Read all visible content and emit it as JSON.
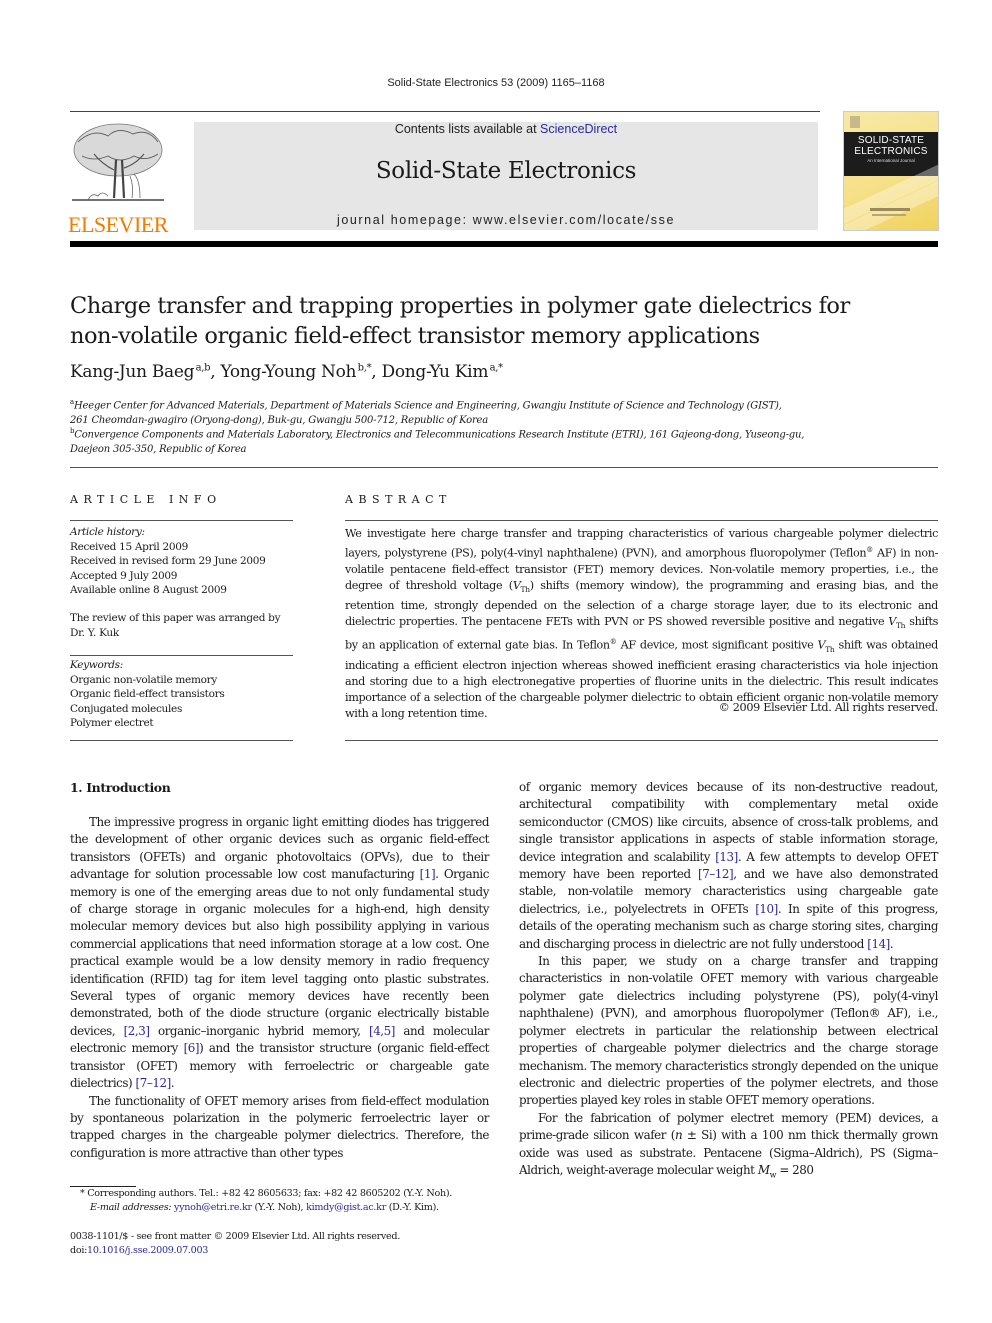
{
  "running_head": "Solid-State Electronics 53 (2009) 1165–1168",
  "publisher": {
    "logo_word": "ELSEVIER",
    "logo_color": "#f07c00"
  },
  "banner": {
    "contents_prefix": "Contents lists available at ",
    "contents_link": "ScienceDirect",
    "journal_title": "Solid-State Electronics",
    "homepage": "journal homepage: www.elsevier.com/locate/sse"
  },
  "cover": {
    "line1": "SOLID-STATE",
    "line2": "ELECTRONICS",
    "line3": "An International Journal"
  },
  "article": {
    "title_line1": "Charge transfer and trapping properties in polymer gate dielectrics for",
    "title_line2": "non-volatile organic field-effect transistor memory applications",
    "authors": [
      {
        "name": "Kang-Jun Baeg",
        "sup": "a,b",
        "sep": ", "
      },
      {
        "name": "Yong-Young Noh",
        "sup": "b,*",
        "sep": ", "
      },
      {
        "name": "Dong-Yu Kim",
        "sup": "a,*",
        "sep": ""
      }
    ],
    "affiliations": [
      {
        "mark": "a",
        "line1": "Heeger Center for Advanced Materials, Department of Materials Science and Engineering, Gwangju Institute of Science and Technology (GIST),",
        "line2": "261 Cheomdan-gwagiro (Oryong-dong), Buk-gu, Gwangju 500-712, Republic of Korea"
      },
      {
        "mark": "b",
        "line1": "Convergence Components and Materials Laboratory, Electronics and Telecommunications Research Institute (ETRI), 161 Gajeong-dong, Yuseong-gu,",
        "line2": "Daejeon 305-350, Republic of Korea"
      }
    ]
  },
  "article_info": {
    "heading": "ARTICLE INFO",
    "history_label": "Article history:",
    "history": [
      "Received 15 April 2009",
      "Received in revised form 29 June 2009",
      "Accepted 9 July 2009",
      "Available online 8 August 2009"
    ],
    "review_note": "The review of this paper was arranged by Dr. Y. Kuk",
    "keywords_label": "Keywords:",
    "keywords": [
      "Organic non-volatile memory",
      "Organic field-effect transistors",
      "Conjugated molecules",
      "Polymer electret"
    ]
  },
  "abstract": {
    "heading": "ABSTRACT",
    "p1": "We investigate here charge transfer and trapping characteristics of various chargeable polymer dielectric layers, polystyrene (PS), poly(4-vinyl naphthalene) (PVN), and amorphous fluoropolymer (Teflon",
    "reg": "®",
    "p2": " AF) in non-volatile pentacene field-effect transistor (FET) memory devices. Non-volatile memory properties, i.e., the degree of threshold voltage (",
    "vth_v": "V",
    "vth_sub": "Th",
    "p3": ") shifts (memory window), the programming and erasing bias, and the retention time, strongly depended on the selection of a charge storage layer, due to its electronic and dielectric properties. The pentacene FETs with PVN or PS showed reversible positive and negative ",
    "p4": " shifts by an application of external gate bias. In Teflon",
    "p5": " AF device, most significant positive ",
    "p6": " shift was obtained indicating a efficient electron injection whereas showed inefficient erasing characteristics via hole injection and storing due to a high electronegative properties of fluorine units in the dielectric. This result indicates importance of a selection of the chargeable polymer dielectric to obtain efficient organic non-volatile memory with a long retention time.",
    "copyright": "© 2009 Elsevier Ltd. All rights reserved."
  },
  "section1": {
    "heading": "1. Introduction",
    "left_p1": [
      {
        "t": "The impressive progress in organic light emitting diodes has triggered the development of other organic devices such as organic field-effect transistors (OFETs) and organic photovoltaics (OPVs), due to their advantage for solution processable low cost manufacturing "
      },
      {
        "ref": "[1]"
      },
      {
        "t": ". Organic memory is one of the emerging areas due to not only fundamental study of charge storage in organic molecules for a high-end, high density molecular memory devices but also high possibility applying in various commercial applications that need information storage at a low cost. One practical example would be a low density memory in radio frequency identification (RFID) tag for item level tagging onto plastic substrates. Several types of organic memory devices have recently been demonstrated, both of the diode structure (organic electrically bistable devices, "
      },
      {
        "ref": "[2,3]"
      },
      {
        "t": " organic–inorganic hybrid memory, "
      },
      {
        "ref": "[4,5]"
      },
      {
        "t": " and molecular electronic memory "
      },
      {
        "ref": "[6]"
      },
      {
        "t": ") and the transistor structure (organic field-effect transistor (OFET) memory with ferroelectric or chargeable gate dielectrics) "
      },
      {
        "ref": "[7–12]"
      },
      {
        "t": "."
      }
    ],
    "left_p2": "The functionality of OFET memory arises from field-effect modulation by spontaneous polarization in the polymeric ferroelectric layer or trapped charges in the chargeable polymer dielectrics. Therefore, the configuration is more attractive than other types",
    "right_p1": [
      {
        "t": "of organic memory devices because of its non-destructive readout, architectural compatibility with complementary metal oxide semiconductor (CMOS) like circuits, absence of cross-talk problems, and single transistor applications in aspects of stable information storage, device integration and scalability "
      },
      {
        "ref": "[13]"
      },
      {
        "t": ". A few attempts to develop OFET memory have been reported "
      },
      {
        "ref": "[7–12]"
      },
      {
        "t": ", and we have also demonstrated stable, non-volatile memory characteristics using chargeable gate dielectrics, i.e., polyelectrets in OFETs "
      },
      {
        "ref": "[10]"
      },
      {
        "t": ". In spite of this progress, details of the operating mechanism such as charge storing sites, charging and discharging process in dielectric are not fully understood "
      },
      {
        "ref": "[14]"
      },
      {
        "t": "."
      }
    ],
    "right_p2": "In this paper, we study on a charge transfer and trapping characteristics in non-volatile OFET memory with various chargeable polymer gate dielectrics including polystyrene (PS), poly(4-vinyl naphthalene) (PVN), and amorphous fluoropolymer (Teflon® AF), i.e., polymer electrets in particular the relationship between electrical properties of chargeable polymer dielectrics and the charge storage mechanism. The memory characteristics strongly depended on the unique electronic and dielectric properties of the polymer electrets, and those properties played key roles in stable OFET memory operations.",
    "right_p3a": "For the fabrication of polymer electret memory (PEM) devices, a prime-grade silicon wafer (",
    "right_p3_n": "n",
    "right_p3b": " ± Si) with a 100 nm thick thermally grown oxide was used as substrate. Pentacene (Sigma–Aldrich), PS (Sigma–Aldrich, weight-average molecular weight ",
    "right_p3_m": "M",
    "right_p3_msub": "w",
    "right_p3c": " = 280"
  },
  "footnote": {
    "star_text": "* Corresponding authors. Tel.: +82 42 8605633; fax: +82 42 8605202 (Y.-Y. Noh).",
    "email_label": "E-mail addresses: ",
    "email1": "yynoh@etri.re.kr",
    "email1_owner": " (Y.-Y. Noh), ",
    "email2": "kimdy@gist.ac.kr",
    "email2_owner": " (D.-Y. Kim)."
  },
  "issn": {
    "line1": "0038-1101/$ - see front matter © 2009 Elsevier Ltd. All rights reserved.",
    "doi_label": "doi:",
    "doi": "10.1016/j.sse.2009.07.003"
  },
  "colors": {
    "link": "#2a2aa0",
    "banner_bg": "#e6e6e6",
    "elsevier_orange": "#f07c00"
  }
}
